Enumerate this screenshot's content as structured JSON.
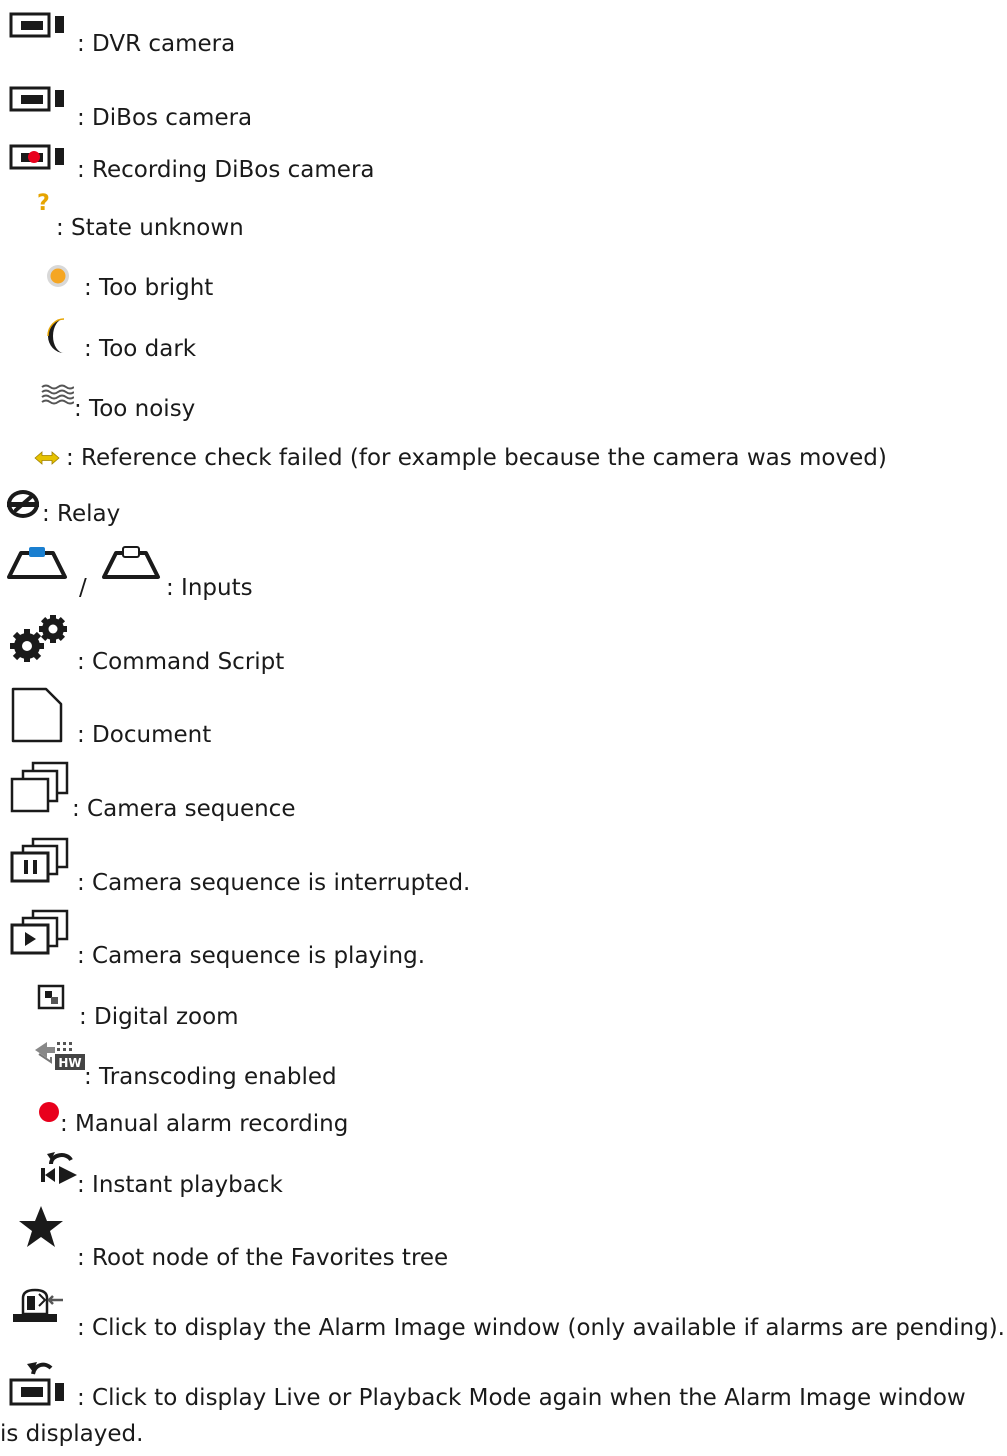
{
  "items": [
    {
      "icon": "dvr-camera-icon",
      "label": ": DVR camera"
    },
    {
      "icon": "dibos-camera-icon",
      "label": ": DiBos camera"
    },
    {
      "icon": "recording-dibos-camera-icon",
      "label": ": Recording DiBos camera"
    },
    {
      "icon": "question-mark-icon",
      "label": ": State unknown"
    },
    {
      "icon": "sun-icon",
      "label": ": Too bright"
    },
    {
      "icon": "moon-icon",
      "label": ": Too dark"
    },
    {
      "icon": "noise-icon",
      "label": ": Too noisy"
    },
    {
      "icon": "double-arrow-icon",
      "label": ": Reference check failed (for example because the camera was moved)"
    },
    {
      "icon": "relay-icon",
      "label": ": Relay"
    },
    {
      "icon": "input-icon",
      "separator": "/",
      "label": ": Inputs"
    },
    {
      "icon": "gears-icon",
      "label": ": Command Script"
    },
    {
      "icon": "document-icon",
      "label": ": Document"
    },
    {
      "icon": "camera-sequence-icon",
      "label": ": Camera sequence"
    },
    {
      "icon": "camera-sequence-paused-icon",
      "label": ": Camera sequence is interrupted."
    },
    {
      "icon": "camera-sequence-playing-icon",
      "label": ": Camera sequence is playing."
    },
    {
      "icon": "digital-zoom-icon",
      "label": ": Digital zoom"
    },
    {
      "icon": "transcoding-icon",
      "label": ": Transcoding enabled",
      "badge": "HW"
    },
    {
      "icon": "red-dot-icon",
      "label": ": Manual alarm recording"
    },
    {
      "icon": "instant-playback-icon",
      "label": ": Instant playback"
    },
    {
      "icon": "star-icon",
      "label": ": Root node of the Favorites tree"
    },
    {
      "icon": "alarm-image-icon",
      "label": ": Click to display the Alarm Image window (only available if alarms are pending)."
    },
    {
      "icon": "back-to-live-icon",
      "label": ": Click to display Live or Playback Mode again when the Alarm Image window is displayed."
    }
  ],
  "colors": {
    "text": "#1a1a1a",
    "recording_red": "#e8001c",
    "input_blue": "#1a7fd0",
    "sun_orange": "#f5a623",
    "arrow_yellow": "#e6c200"
  }
}
